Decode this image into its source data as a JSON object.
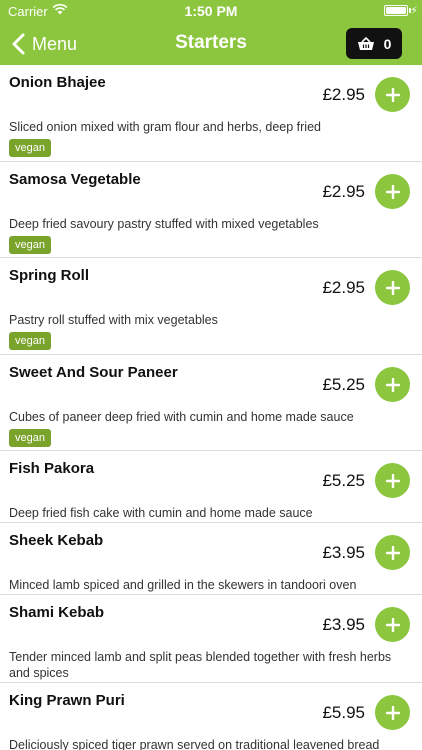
{
  "status_bar": {
    "carrier": "Carrier",
    "time": "1:50 PM"
  },
  "nav": {
    "back_label": "Menu",
    "title": "Starters",
    "cart_count": "0"
  },
  "colors": {
    "brand_green": "#8cc63f",
    "tag_green": "#7aa32b",
    "cart_bg": "#111111"
  },
  "items": [
    {
      "name": "Onion Bhajee",
      "price": "£2.95",
      "description": "Sliced onion mixed with gram flour and herbs, deep fried",
      "tag": "vegan"
    },
    {
      "name": "Samosa Vegetable",
      "price": "£2.95",
      "description": "Deep fried savoury pastry stuffed with mixed vegetables",
      "tag": "vegan"
    },
    {
      "name": "Spring Roll",
      "price": "£2.95",
      "description": "Pastry roll stuffed with mix vegetables",
      "tag": "vegan"
    },
    {
      "name": "Sweet And Sour Paneer",
      "price": "£5.25",
      "description": "Cubes of paneer deep fried with cumin and home made sauce",
      "tag": "vegan"
    },
    {
      "name": "Fish Pakora",
      "price": "£5.25",
      "description": "Deep fried fish cake with cumin and home made sauce"
    },
    {
      "name": "Sheek Kebab",
      "price": "£3.95",
      "description": "Minced lamb spiced and grilled in the skewers in tandoori oven"
    },
    {
      "name": "Shami Kebab",
      "price": "£3.95",
      "description": "Tender minced lamb and split peas blended together with fresh herbs and spices"
    },
    {
      "name": "King Prawn Puri",
      "price": "£5.95",
      "description": "Deliciously spiced tiger prawn served on traditional leavened bread"
    }
  ]
}
